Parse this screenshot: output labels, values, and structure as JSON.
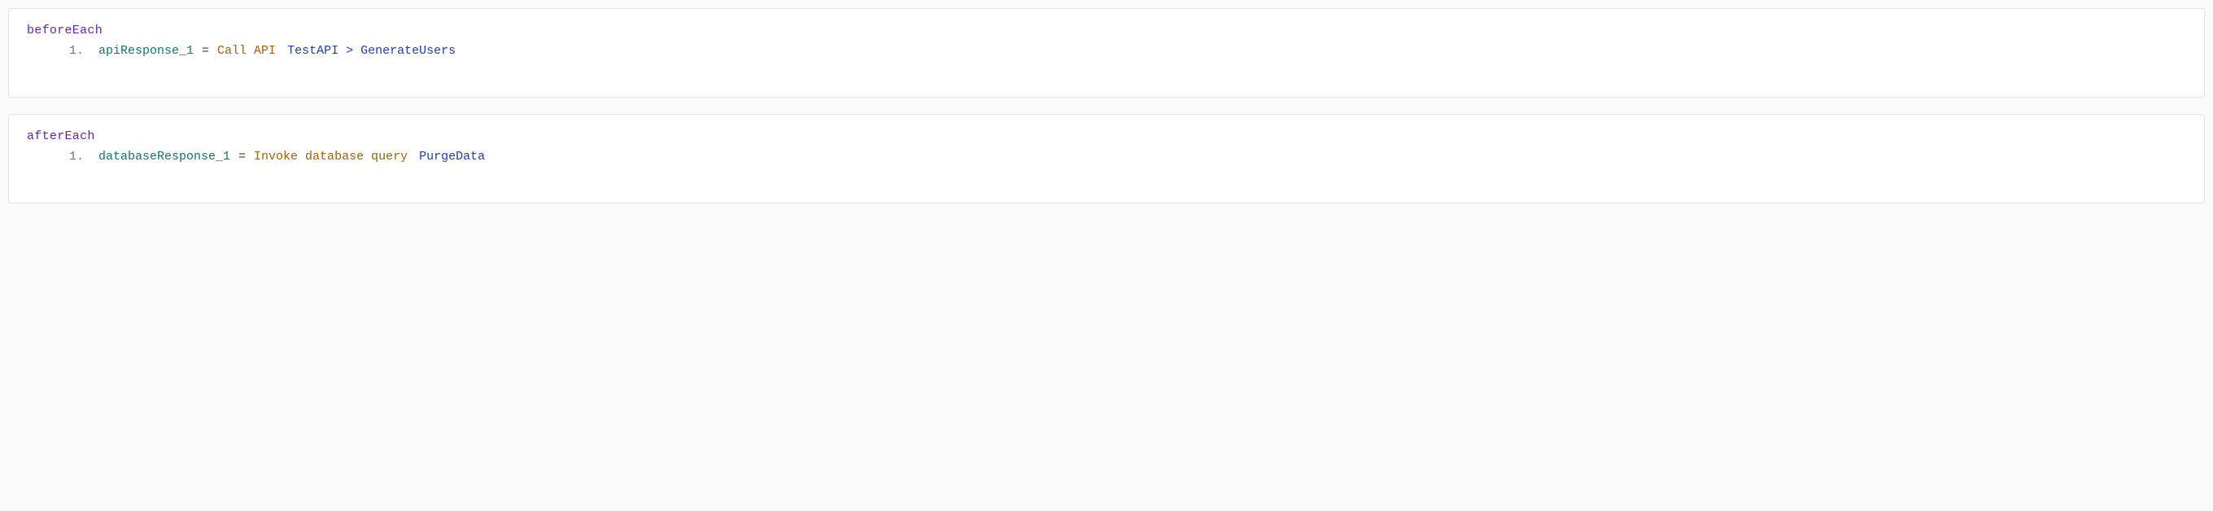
{
  "blocks": [
    {
      "title": "beforeEach",
      "steps": [
        {
          "number": "1.",
          "varName": "apiResponse_1",
          "equals": "=",
          "action": "Call API",
          "target": "TestAPI > GenerateUsers"
        }
      ]
    },
    {
      "title": "afterEach",
      "steps": [
        {
          "number": "1.",
          "varName": "databaseResponse_1",
          "equals": "=",
          "action": "Invoke database query",
          "target": "PurgeData"
        }
      ]
    }
  ]
}
